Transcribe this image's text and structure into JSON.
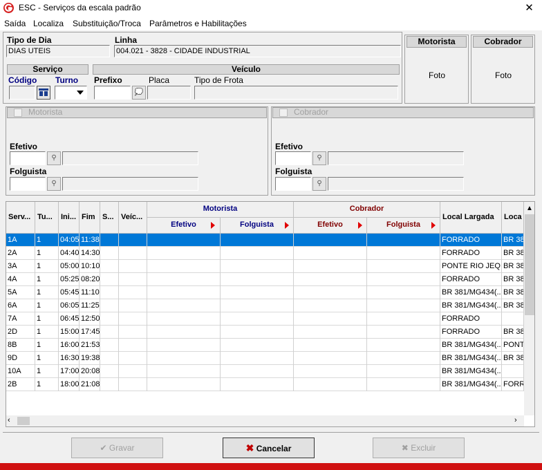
{
  "window": {
    "title": "ESC - Serviços da escala padrão",
    "close": "✕"
  },
  "menu": [
    "Saída",
    "Localiza",
    "Substituição/Troca",
    "Parâmetros e Habilitações"
  ],
  "top": {
    "tipo_dia_label": "Tipo de Dia",
    "tipo_dia_value": "DIAS UTEIS",
    "linha_label": "Linha",
    "linha_value": "004.021 - 3828 - CIDADE INDUSTRIAL",
    "motorista_title": "Motorista",
    "motorista_foto": "Foto",
    "cobrador_title": "Cobrador",
    "cobrador_foto": "Foto"
  },
  "servico": {
    "title": "Serviço",
    "codigo_label": "Código",
    "turno_label": "Turno"
  },
  "veiculo": {
    "title": "Veículo",
    "prefixo_label": "Prefixo",
    "placa_label": "Placa",
    "tipo_frota_label": "Tipo de Frota"
  },
  "motorista_group": {
    "title": "Motorista",
    "efetivo_label": "Efetivo",
    "folguista_label": "Folguista"
  },
  "cobrador_group": {
    "title": "Cobrador",
    "efetivo_label": "Efetivo",
    "folguista_label": "Folguista"
  },
  "grid": {
    "headers": {
      "serv": "Serv...",
      "tu": "Tu...",
      "ini": "Ini...",
      "fim": "Fim",
      "s": "S...",
      "veic": "Veíc...",
      "motorista": "Motorista",
      "cobrador": "Cobrador",
      "m_efetivo": "Efetivo",
      "m_folguista": "Folguista",
      "c_efetivo": "Efetivo",
      "c_folguista": "Folguista",
      "local_largada": "Local Largada",
      "local2": "Loca"
    },
    "colors": {
      "motorista_header": "#000080",
      "cobrador_header": "#800000",
      "selected": "#0078d7",
      "arrow": "#e00000"
    },
    "rows": [
      {
        "serv": "1A",
        "tu": "1",
        "ini": "04:05",
        "fim": "11:38",
        "local": "FORRADO",
        "local2": "BR 38"
      },
      {
        "serv": "2A",
        "tu": "1",
        "ini": "04:40",
        "fim": "14:30",
        "local": "FORRADO",
        "local2": "BR 38"
      },
      {
        "serv": "3A",
        "tu": "1",
        "ini": "05:00",
        "fim": "10:10",
        "local": "PONTE RIO JEQ...",
        "local2": "BR 38"
      },
      {
        "serv": "4A",
        "tu": "1",
        "ini": "05:25",
        "fim": "08:20",
        "local": "FORRADO",
        "local2": "BR 38"
      },
      {
        "serv": "5A",
        "tu": "1",
        "ini": "05:45",
        "fim": "11:10",
        "local": "BR 381/MG434(...",
        "local2": "BR 38"
      },
      {
        "serv": "6A",
        "tu": "1",
        "ini": "06:05",
        "fim": "11:25",
        "local": "BR 381/MG434(...",
        "local2": "BR 38"
      },
      {
        "serv": "7A",
        "tu": "1",
        "ini": "06:45",
        "fim": "12:50",
        "local": "FORRADO",
        "local2": ""
      },
      {
        "serv": "2D",
        "tu": "1",
        "ini": "15:00",
        "fim": "17:45",
        "local": "FORRADO",
        "local2": "BR 38"
      },
      {
        "serv": "8B",
        "tu": "1",
        "ini": "16:00",
        "fim": "21:53",
        "local": "BR 381/MG434(...",
        "local2": "PONT"
      },
      {
        "serv": "9D",
        "tu": "1",
        "ini": "16:30",
        "fim": "19:38",
        "local": "BR 381/MG434(...",
        "local2": "BR 38"
      },
      {
        "serv": "10A",
        "tu": "1",
        "ini": "17:00",
        "fim": "20:08",
        "local": "BR 381/MG434(...",
        "local2": ""
      },
      {
        "serv": "2B",
        "tu": "1",
        "ini": "18:00",
        "fim": "21:08",
        "local": "BR 381/MG434(...",
        "local2": "FORR"
      }
    ]
  },
  "buttons": {
    "gravar": "Gravar",
    "cancelar": "Cancelar",
    "excluir": "Excluir"
  }
}
